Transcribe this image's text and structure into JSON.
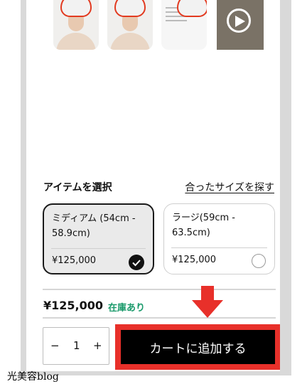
{
  "gallery": {
    "thumbnails": [
      "model-front-image",
      "model-angle-image",
      "spec-sheet-image",
      "video-thumbnail"
    ]
  },
  "item_select": {
    "title": "アイテムを選択",
    "size_link": "合ったサイズを探す"
  },
  "options": [
    {
      "name": "ミディアム (54cm - 58.9cm)",
      "price": "¥125,000",
      "selected": true
    },
    {
      "name": "ラージ(59cm - 63.5cm)",
      "price": "¥125,000",
      "selected": false
    }
  ],
  "summary": {
    "price": "¥125,000",
    "stock": "在庫あり"
  },
  "quantity": {
    "minus": "−",
    "value": "1",
    "plus": "+"
  },
  "cart_button": "カートに追加する",
  "watermark": "光美容blog",
  "colors": {
    "accent": "#e8302a",
    "stock": "#1a9a6b",
    "button": "#000000"
  }
}
